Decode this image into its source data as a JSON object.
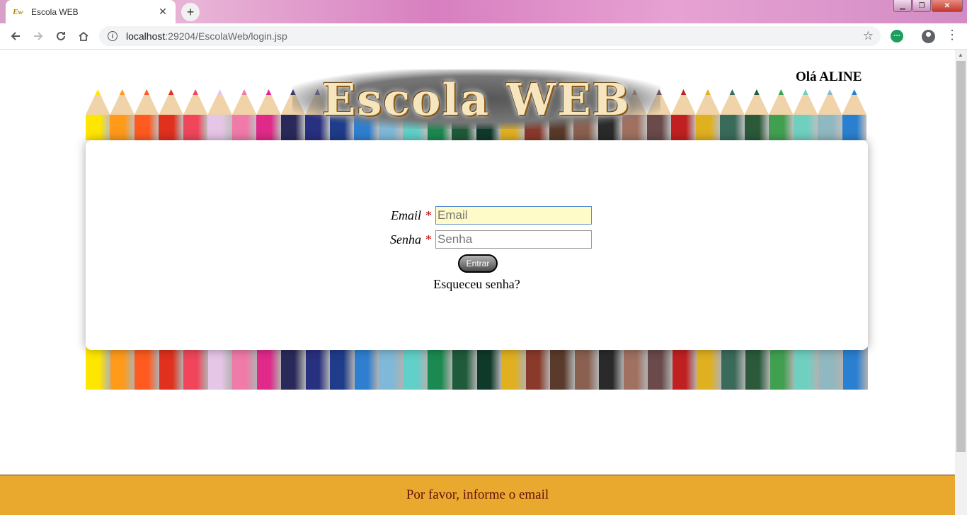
{
  "browser": {
    "tab_title": "Escola WEB",
    "tab_favicon": "Ew",
    "url_host": "localhost",
    "url_path": ":29204/EscolaWeb/login.jsp"
  },
  "header": {
    "logo_text": "Escola WEB",
    "greeting": "Olá ALINE"
  },
  "login": {
    "email_label": "Email",
    "email_placeholder": "Email",
    "senha_label": "Senha",
    "senha_placeholder": "Senha",
    "required_mark": "*",
    "submit_label": "Entrar",
    "forgot_link": "Esqueceu senha?"
  },
  "footer": {
    "message": "Por favor, informe o email"
  },
  "colors": {
    "footer_bg": "#e8a92e",
    "footer_text": "#6a0d0d",
    "required": "#c00000",
    "focused_field_bg": "#fffbc8"
  },
  "pencil_colors": [
    "#ffe600",
    "#ff9a1a",
    "#ff5a1f",
    "#e0301e",
    "#f0455a",
    "#e6c6e6",
    "#f07aa8",
    "#e02a8a",
    "#2a2a5a",
    "#283080",
    "#1f3c8a",
    "#2f7fd0",
    "#7fb8d8",
    "#60d0c8",
    "#1a8a50",
    "#1f5a3a",
    "#0f3a2a",
    "#e0b020",
    "#8a3a2a",
    "#5a3a2a",
    "#8a6050",
    "#2a2a2a",
    "#a07060",
    "#6a4a4a",
    "#c02020",
    "#e0b020",
    "#3a6a5a",
    "#2a5a3a",
    "#40a050",
    "#70d0c0",
    "#90b8c0",
    "#2a80d0"
  ]
}
